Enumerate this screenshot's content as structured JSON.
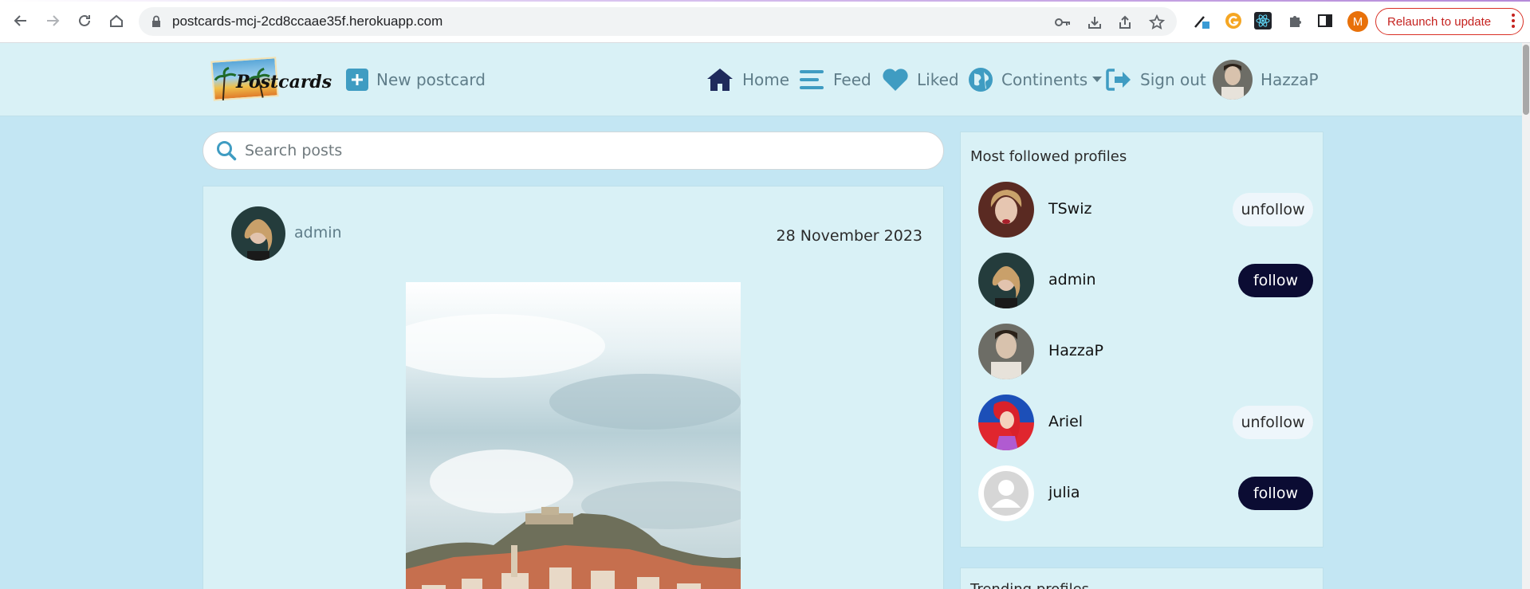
{
  "browser": {
    "url": "postcards-mcj-2cd8ccaae35f.herokuapp.com",
    "profile_initial": "M",
    "relaunch_label": "Relaunch to update"
  },
  "navbar": {
    "logo_text": "Postcards",
    "new_postcard": "New postcard",
    "home": "Home",
    "feed": "Feed",
    "liked": "Liked",
    "continents": "Continents",
    "sign_out": "Sign out",
    "username": "HazzaP"
  },
  "search": {
    "placeholder": "Search posts"
  },
  "post": {
    "author": "admin",
    "date": "28 November 2023"
  },
  "sidebar": {
    "title": "Most followed profiles",
    "profiles": [
      {
        "name": "TSwiz",
        "action": "unfollow"
      },
      {
        "name": "admin",
        "action": "follow"
      },
      {
        "name": "HazzaP",
        "action": ""
      },
      {
        "name": "Ariel",
        "action": "unfollow"
      },
      {
        "name": "julia",
        "action": "follow"
      }
    ],
    "trending_title": "Trending profiles"
  },
  "colors": {
    "page_bg": "#c3e6f3",
    "card_bg": "#d9f1f6",
    "nav_text": "#5f7d89",
    "follow_bg": "#0b0c33",
    "unfollow_bg": "#eef6fb",
    "home_icon": "#1f2a5c",
    "accent_icon": "#3f9cc2"
  }
}
